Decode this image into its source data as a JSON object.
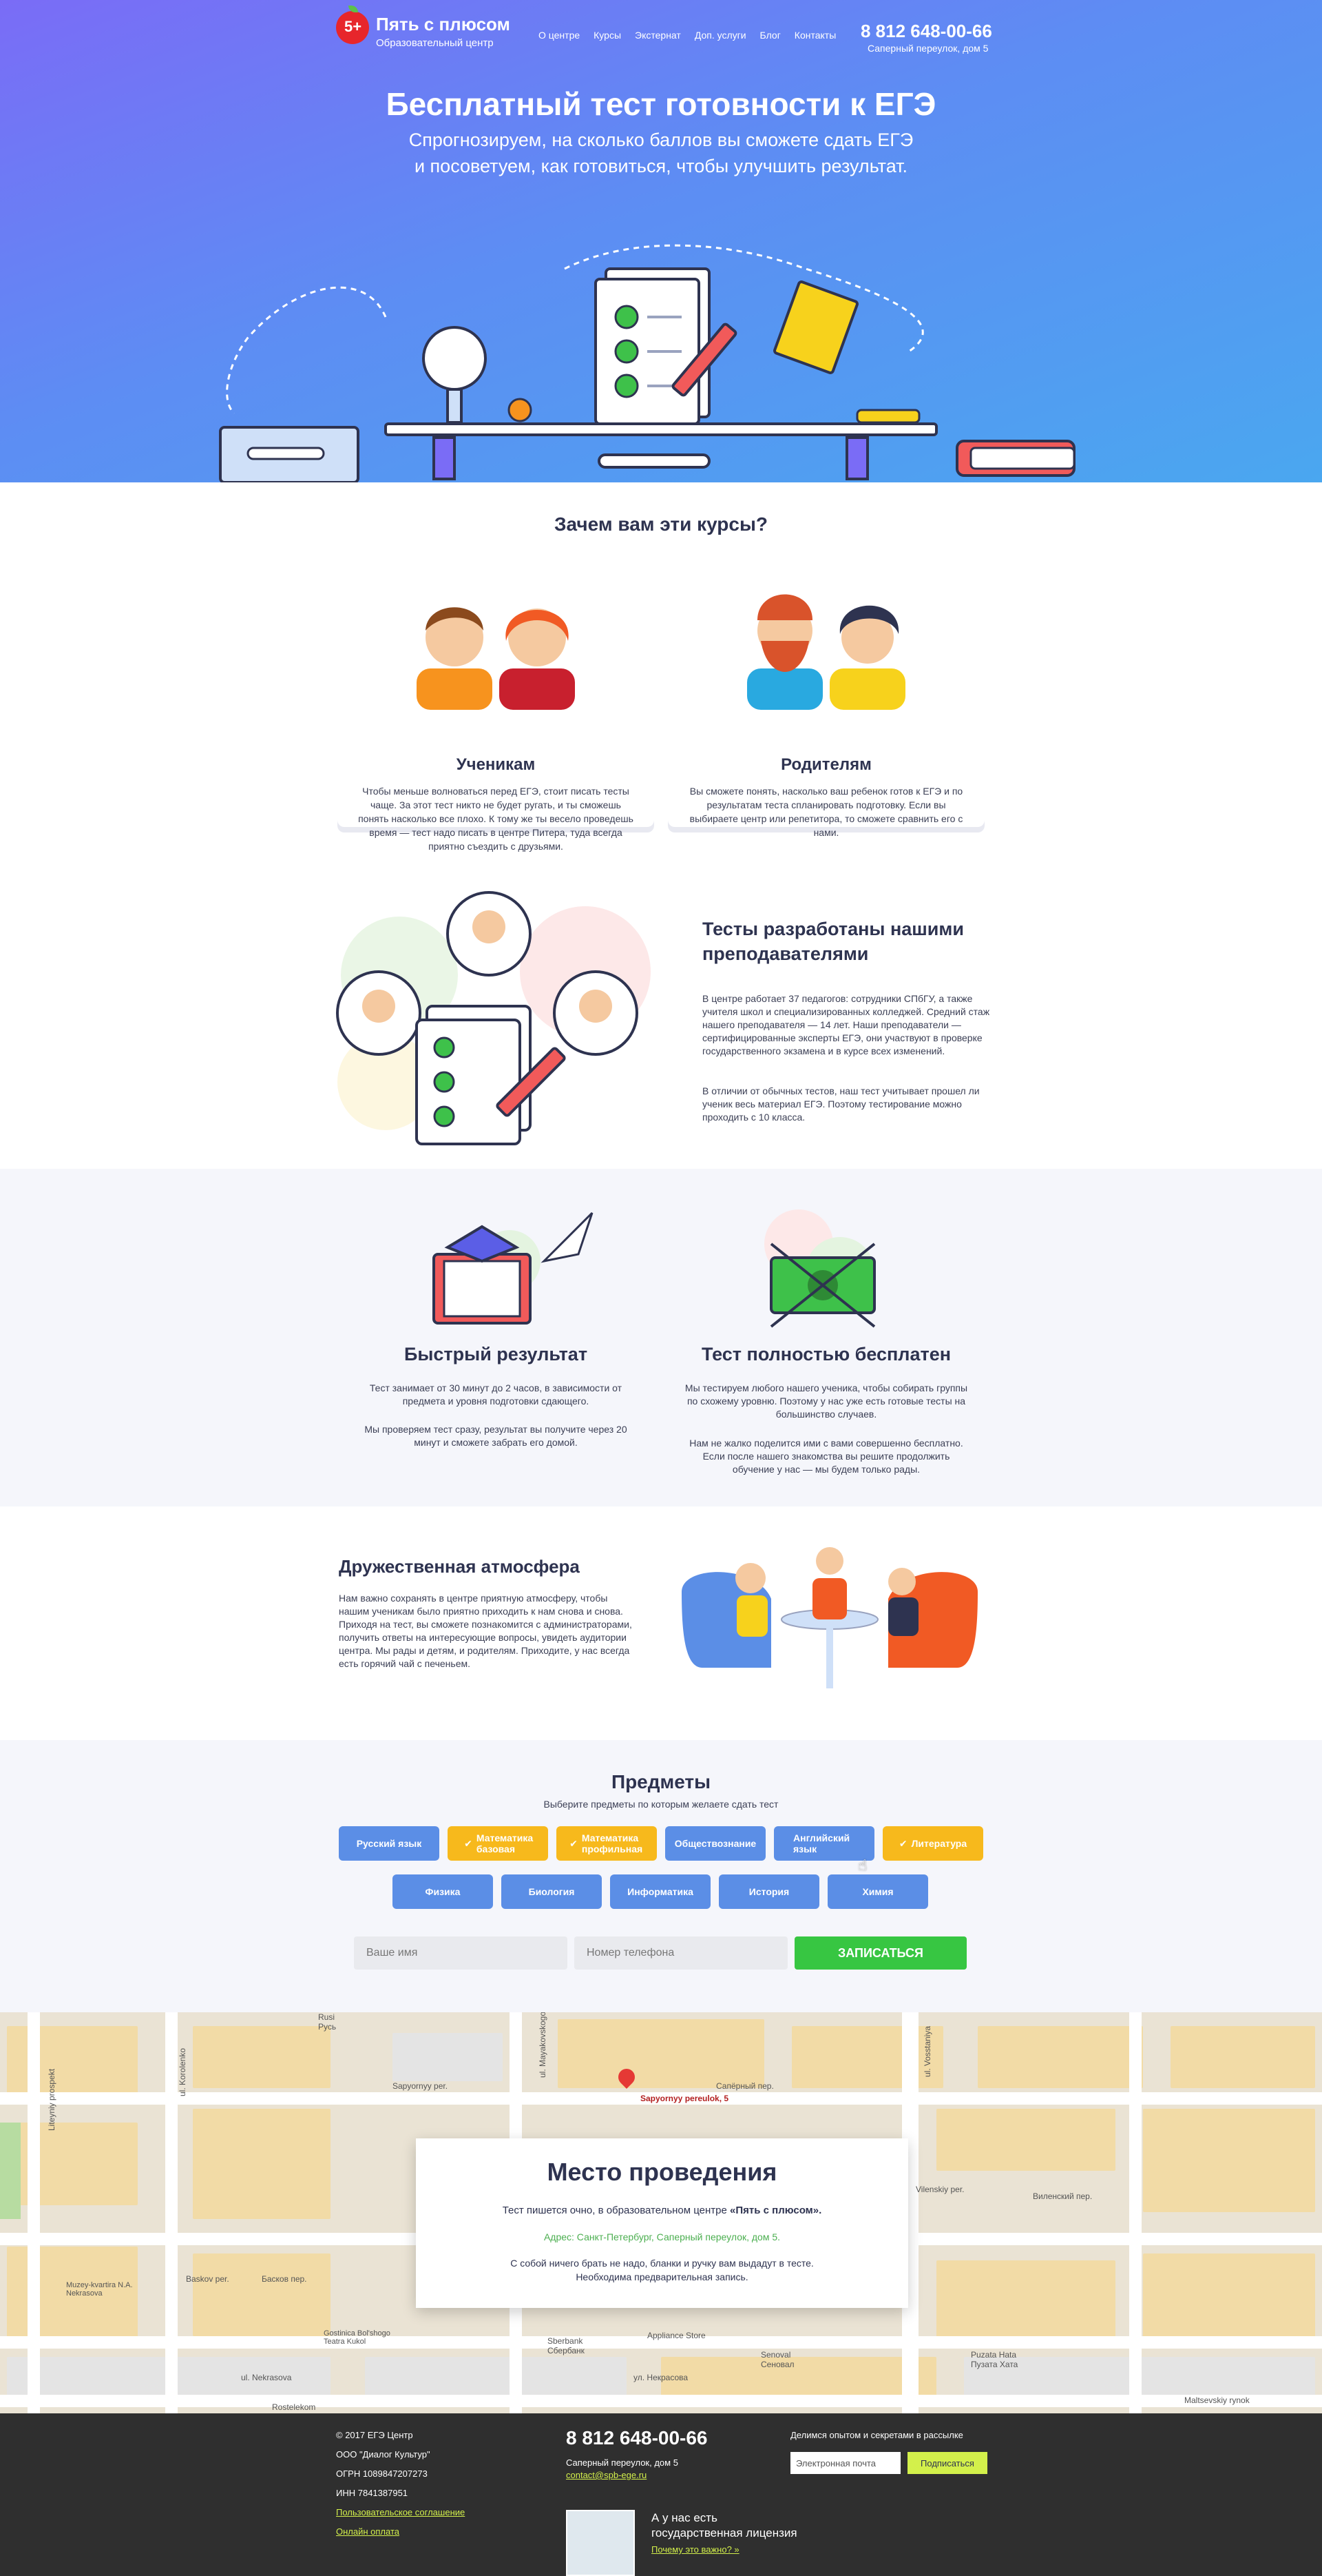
{
  "header": {
    "logo_badge": "5+",
    "logo_title": "Пять с плюсом",
    "logo_subtitle": "Образовательный центр",
    "nav": [
      "О центре",
      "Курсы",
      "Экстернат",
      "Доп. услуги",
      "Блог",
      "Контакты"
    ],
    "phone": "8 812 648-00-66",
    "address": "Саперный переулок, дом 5"
  },
  "hero": {
    "title": "Бесплатный тест готовности к ЕГЭ",
    "subtitle_line1": "Спрогнозируем, на сколько баллов вы сможете сдать ЕГЭ",
    "subtitle_line2": "и посоветуем, как готовиться, чтобы улучшить результат."
  },
  "why": {
    "title": "Зачем вам эти курсы?",
    "cards": [
      {
        "title": "Ученикам",
        "text": "Чтобы меньше волноваться перед ЕГЭ, стоит писать тесты чаще. За этот тест никто не будет ругать, и ты сможешь понять насколько все плохо. К тому же ты весело проведешь время — тест надо писать в центре Питера, туда всегда приятно съездить с друзьями."
      },
      {
        "title": "Родителям",
        "text": "Вы сможете понять, насколько ваш ребенок готов к ЕГЭ и по результатам теста спланировать подготовку. Если вы выбираете центр или репетитора, то сможете сравнить его с нами."
      }
    ]
  },
  "teachers": {
    "title_line1": "Тесты разработаны нашими",
    "title_line2": "преподавателями",
    "p1": "В центре работает 37 педагогов: сотрудники СПбГУ, а также учителя школ и специализированных колледжей. Средний стаж нашего преподавателя — 14 лет. Наши преподаватели — сертифицированные эксперты ЕГЭ, они участвуют в проверке государственного экзамена и в курсе всех изменений.",
    "p2": "В отличии от обычных тестов, наш тест учитывает прошел ли ученик весь материал ЕГЭ. Поэтому тестирование можно проходить с 10 класса."
  },
  "features": [
    {
      "title": "Быстрый результат",
      "p1": "Тест занимает от 30 минут до 2 часов, в зависимости от предмета и уровня подготовки сдающего.",
      "p2": "Мы проверяем тест сразу, результат вы получите через 20 минут и сможете забрать его домой."
    },
    {
      "title": "Тест полностью бесплатен",
      "p1": "Мы тестируем любого нашего ученика, чтобы собирать группы по схожему уровню. Поэтому у нас уже есть готовые тесты на большинство случаев.",
      "p2": "Нам не жалко поделится ими с вами совершенно бесплатно. Если после нашего знакомства вы решите продолжить обучение у нас — мы будем только рады."
    }
  ],
  "atmosphere": {
    "title": "Дружественная атмосфера",
    "text": "Нам важно сохранять в центре приятную атмосферу, чтобы нашим ученикам было приятно приходить к нам снова и снова. Приходя на тест, вы сможете познакомится с администраторами, получить ответы на интересующие вопросы, увидеть аудитории центра. Мы рады и детям, и родителям. Приходите, у нас всегда есть горячий чай с печеньем."
  },
  "subjects": {
    "title": "Предметы",
    "subtitle": "Выберите предметы по которым желаете сдать тест",
    "row1": [
      {
        "label": "Русский язык",
        "selected": false
      },
      {
        "label": "Математика базовая",
        "selected": true
      },
      {
        "label": "Математика профильная",
        "selected": true
      },
      {
        "label": "Обществознание",
        "selected": false
      },
      {
        "label": "Английский язык",
        "selected": false
      },
      {
        "label": "Литература",
        "selected": true
      }
    ],
    "row2": [
      {
        "label": "Физика",
        "selected": false
      },
      {
        "label": "Биология",
        "selected": false
      },
      {
        "label": "Информатика",
        "selected": false
      },
      {
        "label": "История",
        "selected": false
      },
      {
        "label": "Химия",
        "selected": false
      }
    ],
    "name_placeholder": "Ваше имя",
    "phone_placeholder": "Номер телефона",
    "submit": "ЗАПИСАТЬСЯ"
  },
  "map": {
    "marker_label": "Sapyornyy pereulok, 5",
    "labels": [
      "Rusi",
      "Русь",
      "Sapyornyy per.",
      "Сапёрный пер.",
      "Vilenskiy per.",
      "Виленский пер.",
      "Baskov per.",
      "Басков пер.",
      "ul. Nekrasova",
      "ул. Некрасова",
      "Muzey-kvartira N.A. Nekrasova",
      "Gostinica Bol'shogo Teatra Kukol",
      "Sberbank",
      "Сбербанк",
      "Appliance Store",
      "Senoval",
      "Сеновал",
      "Puzata Hata",
      "Пузата Хата",
      "Maltsevskiy rynok",
      "Rostelekom",
      "ul. Vosstaniya",
      "ul. Mayakovskogo",
      "ul. Korolenko",
      "Liteyniy prospekt"
    ]
  },
  "venue": {
    "title": "Место проведения",
    "line1_prefix": "Тест пишется очно, в образовательном центре ",
    "line1_bold": "«Пять с плюсом».",
    "address": "Адрес: Санкт-Петербург, Саперный переулок, дом 5.",
    "line3": "С собой ничего брать не надо, бланки и ручку вам выдадут в тесте.",
    "line4": "Необходима предварительная запись."
  },
  "footer": {
    "copyright": "© 2017 ЕГЭ Центр",
    "company": "ООО \"Диалог Культур\"",
    "ogrn": "ОГРН 1089847207273",
    "inn": "ИНН 7841387951",
    "link_agreement": "Пользовательское соглашение",
    "link_payment": "Онлайн оплата",
    "phone": "8 812 648-00-66",
    "address": "Саперный переулок, дом 5",
    "email": "contact@spb-ege.ru",
    "license_line1": "А у нас есть",
    "license_line2": "государственная лицензия",
    "license_link": "Почему это важно? »",
    "newsletter_title": "Делимся опытом и секретами в рассылке",
    "email_placeholder": "Электронная почта",
    "subscribe": "Подписаться"
  },
  "colors": {
    "accent_blue": "#5b8ee6",
    "accent_yellow": "#f7b91c",
    "green": "#37c642",
    "footer_link": "#d3f04b"
  }
}
